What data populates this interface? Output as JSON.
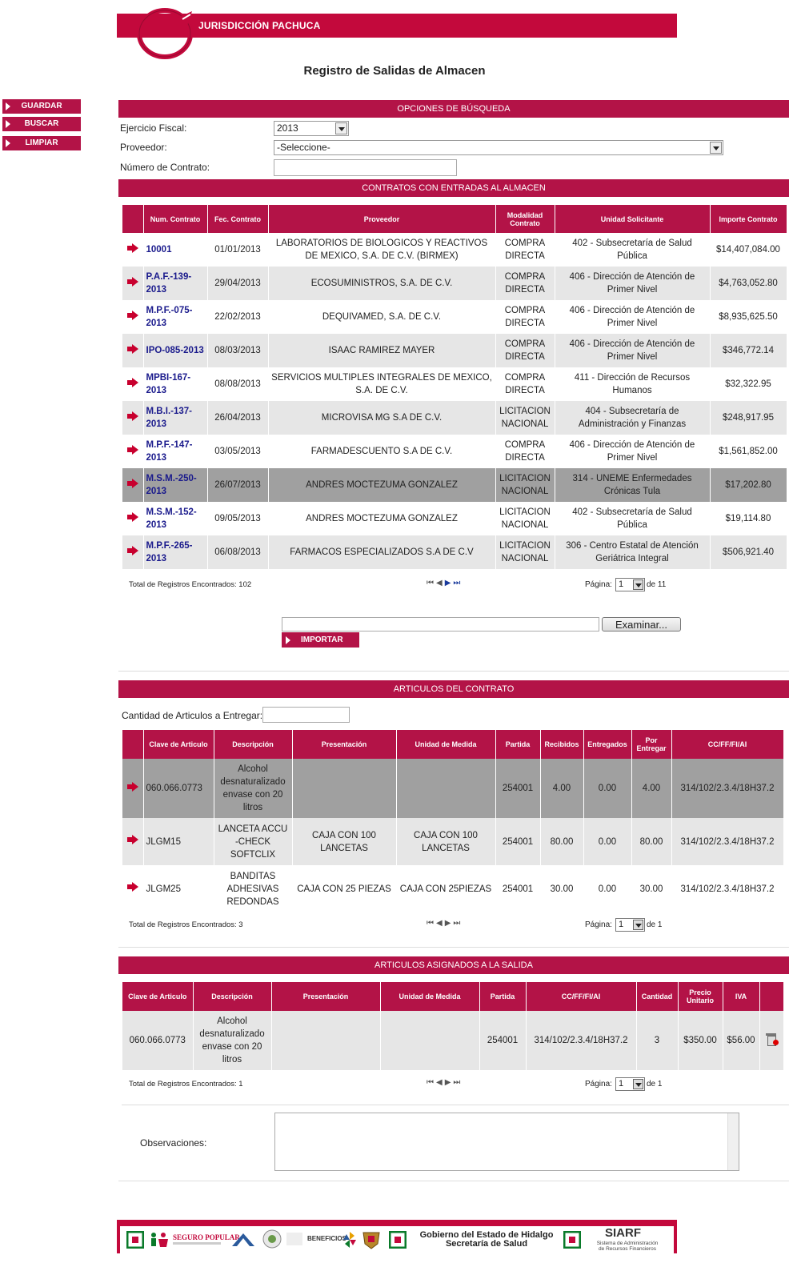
{
  "header": {
    "banner_title": "JURISDICCIÓN PACHUCA",
    "page_title": "Registro de Salidas de Almacen",
    "brand_color": "#c3093c"
  },
  "sidebar": {
    "items": [
      {
        "label": "GUARDAR"
      },
      {
        "label": "BUSCAR"
      },
      {
        "label": "LIMPIAR"
      }
    ]
  },
  "search": {
    "section_title": "OPCIONES DE BÚSQUEDA",
    "ejercicio_label": "Ejercicio Fiscal:",
    "ejercicio_value": "2013",
    "proveedor_label": "Proveedor:",
    "proveedor_value": "-Seleccione-",
    "contrato_label": "Número de Contrato:",
    "contrato_value": ""
  },
  "contracts": {
    "section_title": "CONTRATOS CON ENTRADAS AL ALMACEN",
    "columns": [
      "Num. Contrato",
      "Fec. Contrato",
      "Proveedor",
      "Modalidad Contrato",
      "Unidad Solicitante",
      "Importe Contrato"
    ],
    "rows": [
      {
        "num": "10001",
        "fecha": "01/01/2013",
        "proveedor": "LABORATORIOS DE BIOLOGICOS Y REACTIVOS DE MEXICO, S.A. DE C.V. (BIRMEX)",
        "modalidad": "COMPRA DIRECTA",
        "unidad": "402 - Subsecretaría de Salud Pública",
        "importe": "$14,407,084.00"
      },
      {
        "num": "P.A.F.-139-2013",
        "fecha": "29/04/2013",
        "proveedor": "ECOSUMINISTROS, S.A. DE C.V.",
        "modalidad": "COMPRA DIRECTA",
        "unidad": "406 - Dirección de Atención de Primer Nivel",
        "importe": "$4,763,052.80"
      },
      {
        "num": "M.P.F.-075-2013",
        "fecha": "22/02/2013",
        "proveedor": "DEQUIVAMED, S.A. DE C.V.",
        "modalidad": "COMPRA DIRECTA",
        "unidad": "406 - Dirección de Atención de Primer Nivel",
        "importe": "$8,935,625.50"
      },
      {
        "num": "IPO-085-2013",
        "fecha": "08/03/2013",
        "proveedor": "ISAAC RAMIREZ MAYER",
        "modalidad": "COMPRA DIRECTA",
        "unidad": "406 - Dirección de Atención de Primer Nivel",
        "importe": "$346,772.14"
      },
      {
        "num": "MPBI-167-2013",
        "fecha": "08/08/2013",
        "proveedor": "SERVICIOS MULTIPLES INTEGRALES DE MEXICO, S.A. DE C.V.",
        "modalidad": "COMPRA DIRECTA",
        "unidad": "411 - Dirección de Recursos Humanos",
        "importe": "$32,322.95"
      },
      {
        "num": "M.B.I.-137-2013",
        "fecha": "26/04/2013",
        "proveedor": "MICROVISA MG S.A DE C.V.",
        "modalidad": "LICITACION NACIONAL",
        "unidad": "404 - Subsecretaría de Administración y Finanzas",
        "importe": "$248,917.95"
      },
      {
        "num": "M.P.F.-147-2013",
        "fecha": "03/05/2013",
        "proveedor": "FARMADESCUENTO S.A DE C.V.",
        "modalidad": "COMPRA DIRECTA",
        "unidad": "406 - Dirección de Atención de Primer Nivel",
        "importe": "$1,561,852.00"
      },
      {
        "num": "M.S.M.-250-2013",
        "fecha": "26/07/2013",
        "proveedor": "ANDRES MOCTEZUMA GONZALEZ",
        "modalidad": "LICITACION NACIONAL",
        "unidad": "314 - UNEME Enfermedades Crónicas Tula",
        "importe": "$17,202.80"
      },
      {
        "num": "M.S.M.-152-2013",
        "fecha": "09/05/2013",
        "proveedor": "ANDRES MOCTEZUMA GONZALEZ",
        "modalidad": "LICITACION NACIONAL",
        "unidad": "402 - Subsecretaría de Salud Pública",
        "importe": "$19,114.80"
      },
      {
        "num": "M.P.F.-265-2013",
        "fecha": "06/08/2013",
        "proveedor": "FARMACOS ESPECIALIZADOS S.A DE C.V",
        "modalidad": "LICITACION NACIONAL",
        "unidad": "306 - Centro Estatal de Atención Geriátrica Integral",
        "importe": "$506,921.40"
      }
    ],
    "total": "Total de Registros Encontrados: 102",
    "page_label": "Página:",
    "page_value": "1",
    "page_of": "de 11"
  },
  "import": {
    "file_value": "",
    "browse_label": "Examinar...",
    "import_label": "IMPORTAR"
  },
  "articles": {
    "section_title": "ARTICULOS DEL CONTRATO",
    "qty_label": "Cantidad de Articulos a Entregar:",
    "qty_value": "",
    "columns": [
      "Clave de Articulo",
      "Descripción",
      "Presentación",
      "Unidad de Medida",
      "Partida",
      "Recibidos",
      "Entregados",
      "Por Entregar",
      "CC/FF/FI/AI"
    ],
    "rows": [
      {
        "clave": "060.066.0773",
        "desc": "Alcohol desnaturalizado envase con 20 litros",
        "pres": "",
        "unidad": "",
        "partida": "254001",
        "recibidos": "4.00",
        "entregados": "0.00",
        "por": "4.00",
        "cc": "314/102/2.3.4/18H37.2"
      },
      {
        "clave": "JLGM15",
        "desc": "LANCETA ACCU -CHECK SOFTCLIX",
        "pres": "CAJA CON 100 LANCETAS",
        "unidad": "CAJA CON 100 LANCETAS",
        "partida": "254001",
        "recibidos": "80.00",
        "entregados": "0.00",
        "por": "80.00",
        "cc": "314/102/2.3.4/18H37.2"
      },
      {
        "clave": "JLGM25",
        "desc": "BANDITAS ADHESIVAS REDONDAS",
        "pres": "CAJA CON 25 PIEZAS",
        "unidad": "CAJA CON 25PIEZAS",
        "partida": "254001",
        "recibidos": "30.00",
        "entregados": "0.00",
        "por": "30.00",
        "cc": "314/102/2.3.4/18H37.2"
      }
    ],
    "total": "Total de Registros Encontrados: 3",
    "page_label": "Página:",
    "page_value": "1",
    "page_of": "de 1"
  },
  "assigned": {
    "section_title": "ARTICULOS ASIGNADOS A LA SALIDA",
    "columns": [
      "Clave de Articulo",
      "Descripción",
      "Presentación",
      "Unidad de Medida",
      "Partida",
      "CC/FF/FI/AI",
      "Cantidad",
      "Precio Unitario",
      "IVA"
    ],
    "rows": [
      {
        "clave": "060.066.0773",
        "desc": "Alcohol desnaturalizado envase con 20 litros",
        "pres": "",
        "unidad": "",
        "partida": "254001",
        "cc": "314/102/2.3.4/18H37.2",
        "cantidad": "3",
        "precio": "$350.00",
        "iva": "$56.00"
      }
    ],
    "total": "Total de Registros Encontrados: 1",
    "page_label": "Página:",
    "page_value": "1",
    "page_of": "de 1"
  },
  "observations": {
    "label": "Observaciones:",
    "value": ""
  },
  "footer": {
    "seguro": "SEGURO POPULAR",
    "beneficios": "BENEFICIOS",
    "gov_line1": "Gobierno del Estado de Hidalgo",
    "gov_line2": "Secretaría de Salud",
    "siarf": "SIARF",
    "siarf_sub1": "Sistema de Administración",
    "siarf_sub2": "de Recursos Financieros"
  }
}
